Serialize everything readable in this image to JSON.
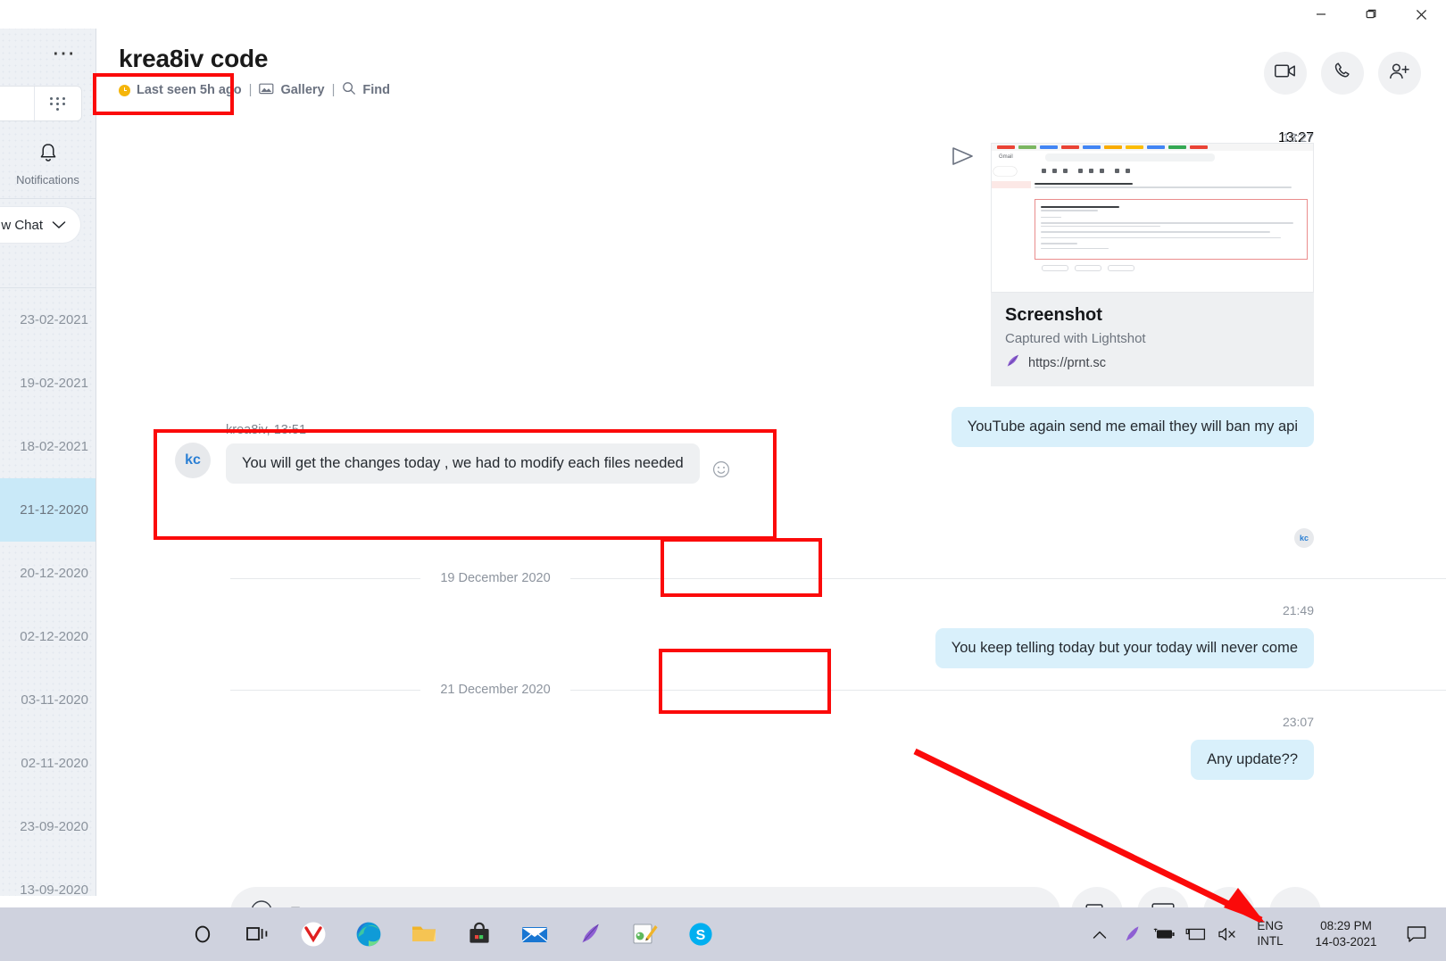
{
  "window": {
    "controls": [
      "minimize",
      "restore",
      "close"
    ]
  },
  "sidebar": {
    "menu_icon": "more-horizontal-icon",
    "apps_icon": "app-grid-icon",
    "notifications_label": "Notifications",
    "notifications_icon": "bell-icon",
    "new_chat_label": "w Chat",
    "new_chat_caret": "chevron-down-icon",
    "items": [
      {
        "date": "23-02-2021",
        "active": false
      },
      {
        "date": "19-02-2021",
        "active": false
      },
      {
        "date": "18-02-2021",
        "active": false
      },
      {
        "date": "21-12-2020",
        "active": true
      },
      {
        "date": "20-12-2020",
        "active": false
      },
      {
        "date": "02-12-2020",
        "active": false
      },
      {
        "date": "03-11-2020",
        "active": false
      },
      {
        "date": "02-11-2020",
        "active": false
      },
      {
        "date": "23-09-2020",
        "active": false
      },
      {
        "date": "13-09-2020",
        "active": false
      }
    ]
  },
  "header": {
    "title": "krea8iv code",
    "status": "Last seen 5h ago",
    "status_icon": "clock-icon",
    "separator": "|",
    "gallery_label": "Gallery",
    "gallery_icon": "image-icon",
    "find_label": "Find",
    "find_icon": "search-icon",
    "actions": [
      {
        "name": "video-call-button",
        "icon": "video-camera-icon"
      },
      {
        "name": "audio-call-button",
        "icon": "phone-icon"
      },
      {
        "name": "add-people-button",
        "icon": "person-add-icon"
      }
    ]
  },
  "conversation": {
    "attachment": {
      "timestamp": "13:27",
      "send_icon": "send-icon",
      "title": "Screenshot",
      "description": "Captured with Lightshot",
      "link": "https://prnt.sc",
      "link_icon": "lightshot-feather-icon"
    },
    "messages": [
      {
        "id": "msg-youtube-ban",
        "direction": "outgoing",
        "text": "YouTube again send me email they will ban my api"
      },
      {
        "id": "msg-changes-today",
        "direction": "incoming",
        "sender": "krea8iv",
        "time": "13:51",
        "meta": "krea8iv, 13:51",
        "avatar_initials": "kc",
        "text": "You will get the changes today , we had to modify each files needed",
        "reaction_icon": "emoji-smiley-icon"
      },
      {
        "id": "msg-never-come",
        "direction": "outgoing",
        "timestamp": "21:49",
        "text": "You keep telling today but your today will never come"
      },
      {
        "id": "msg-any-update",
        "direction": "outgoing",
        "timestamp": "23:07",
        "text": "Any update??"
      }
    ],
    "read_avatar_initials": "kc",
    "date_separators": [
      {
        "id": "sep-19-dec",
        "label": "19 December 2020"
      },
      {
        "id": "sep-21-dec",
        "label": "21 December 2020"
      }
    ]
  },
  "composer": {
    "emoji_icon": "emoji-smiley-icon",
    "placeholder": "Type a message",
    "value": "",
    "actions": [
      {
        "name": "send-image-button",
        "icon": "image-send-icon"
      },
      {
        "name": "send-contact-button",
        "icon": "contact-card-icon"
      },
      {
        "name": "voice-message-button",
        "icon": "microphone-icon"
      },
      {
        "name": "more-options-button",
        "icon": "more-horizontal-icon"
      }
    ]
  },
  "taskbar": {
    "apps": [
      {
        "name": "cortana-search-icon",
        "label": "Search"
      },
      {
        "name": "task-view-icon",
        "label": "Task View"
      },
      {
        "name": "yandex-browser-icon",
        "label": "Yandex Browser"
      },
      {
        "name": "microsoft-edge-icon",
        "label": "Microsoft Edge"
      },
      {
        "name": "file-explorer-icon",
        "label": "File Explorer"
      },
      {
        "name": "microsoft-store-icon",
        "label": "Microsoft Store"
      },
      {
        "name": "mail-icon",
        "label": "Mail"
      },
      {
        "name": "lightshot-icon",
        "label": "Lightshot"
      },
      {
        "name": "paint-icon",
        "label": "Paint"
      },
      {
        "name": "skype-icon",
        "label": "Skype"
      }
    ],
    "tray": {
      "overflow_icon": "chevron-up-icon",
      "lightshot_icon": "lightshot-feather-icon",
      "battery_icon": "battery-charging-icon",
      "display_icon": "display-icon",
      "volume_icon": "volume-muted-icon",
      "language_line1": "ENG",
      "language_line2": "INTL",
      "time": "08:29 PM",
      "date": "14-03-2021",
      "action_center_icon": "action-center-icon"
    }
  },
  "annotations": {
    "color": "#fb0a0a",
    "boxes": [
      {
        "id": "anno-last-seen",
        "target": "header-status"
      },
      {
        "id": "anno-incoming-message",
        "target": "msg-changes-today"
      },
      {
        "id": "anno-date-19-dec",
        "target": "sep-19-dec"
      },
      {
        "id": "anno-date-21-dec",
        "target": "sep-21-dec"
      }
    ],
    "arrow": {
      "id": "anno-arrow-to-tray",
      "target": "taskbar-tray"
    }
  }
}
